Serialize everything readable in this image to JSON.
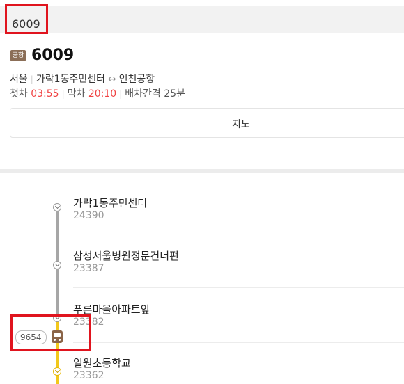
{
  "search": {
    "query": "6009"
  },
  "route": {
    "badge": "공항",
    "number": "6009",
    "region": "서울",
    "start": "가락1동주민센터",
    "arrow": "↔",
    "end": "인천공항",
    "first_label": "첫차",
    "first_time": "03:55",
    "last_label": "막차",
    "last_time": "20:10",
    "interval": "배차간격 25분"
  },
  "map_button": {
    "label": "지도"
  },
  "stops": [
    {
      "name": "가락1동주민센터",
      "id": "24390"
    },
    {
      "name": "삼성서울병원정문건너편",
      "id": "23387"
    },
    {
      "name": "푸른마을아파트앞",
      "id": "23382"
    },
    {
      "name": "일원초등학교",
      "id": "23362"
    }
  ],
  "bus": {
    "plate": "9654",
    "icon": "bus-icon"
  },
  "colors": {
    "accent_red": "#f04343",
    "line_gray": "#a6a6a6",
    "line_yellow": "#f2c81b",
    "bus_brown": "#8a6447"
  }
}
